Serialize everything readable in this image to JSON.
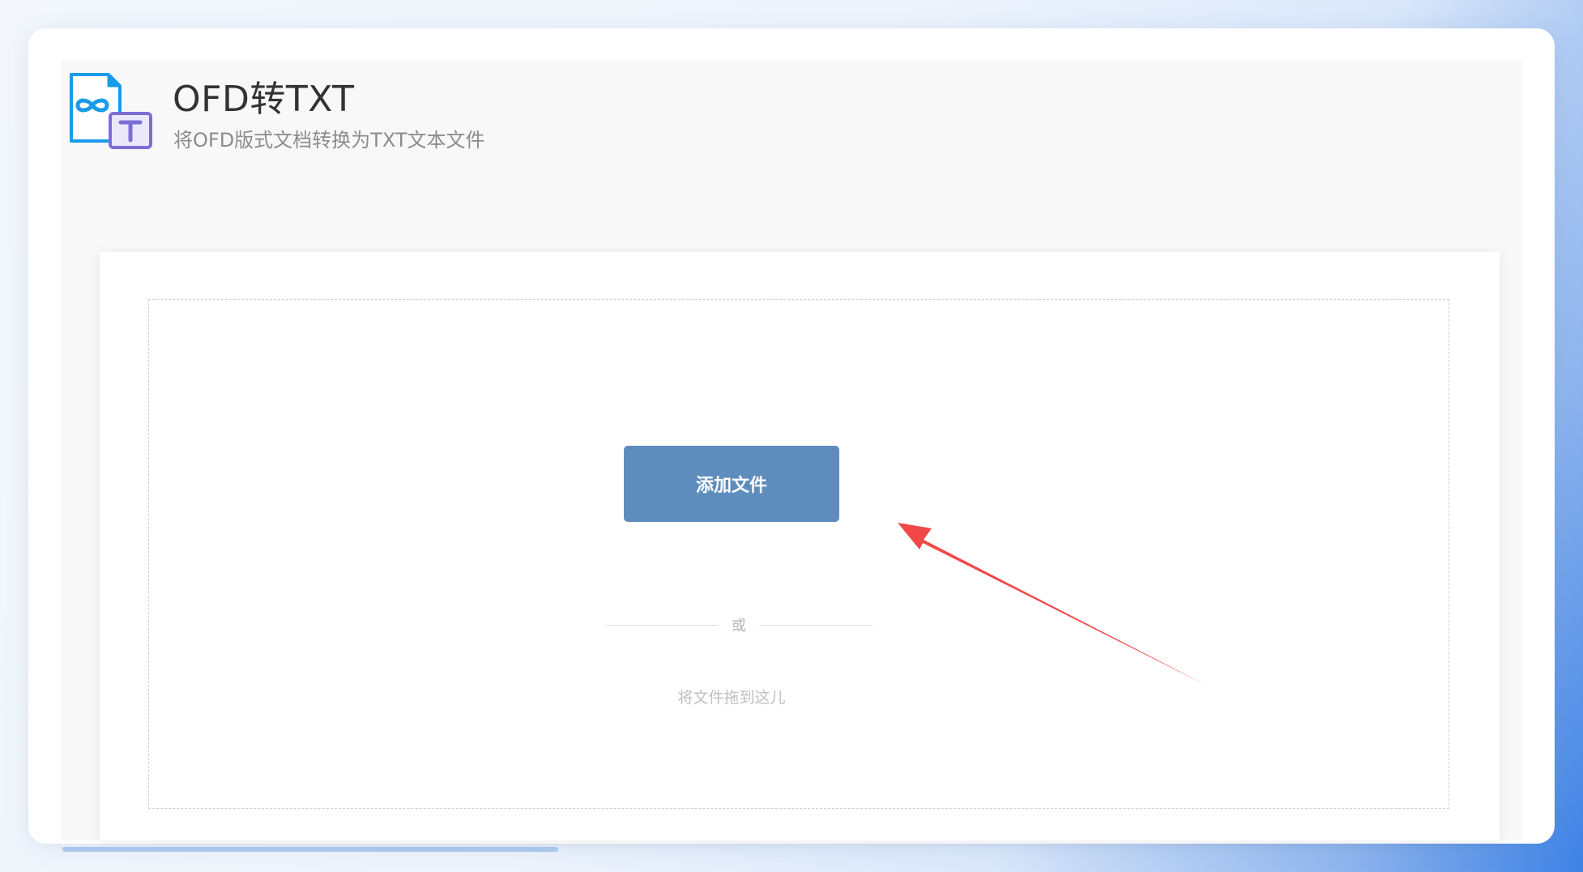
{
  "header": {
    "title": "OFD转TXT",
    "subtitle": "将OFD版式文档转换为TXT文本文件",
    "icon": "ofd-to-txt-icon"
  },
  "upload": {
    "add_button_label": "添加文件",
    "or_label": "或",
    "drop_hint": "将文件拖到这儿"
  },
  "colors": {
    "button": "#5e8dbd",
    "annotation_arrow": "#f04848",
    "ofd_icon": "#1a9be8",
    "txt_badge": "#7b6fd6"
  }
}
